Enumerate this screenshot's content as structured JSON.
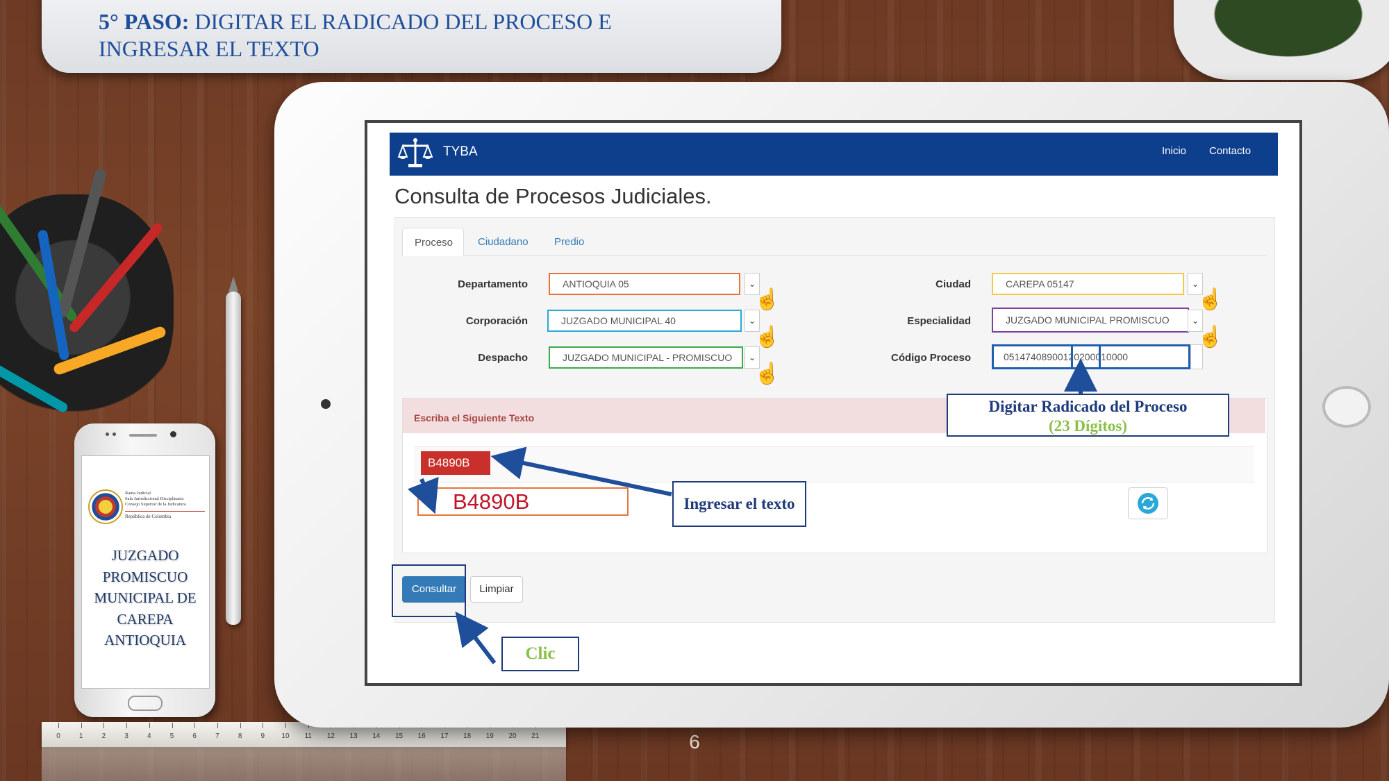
{
  "slide": {
    "title_bold": "5° PASO:",
    "title_rest": " DIGITAR EL RADICADO DEL PROCESO E INGRESAR EL TEXTO",
    "page_number": "6"
  },
  "phone": {
    "seal_lines": [
      "Rama Judicial",
      "Sala Jurisdiccional Disciplinaria",
      "Consejo Superior de la Judicatura"
    ],
    "seal_country": "República de Colombia",
    "title": "JUZGADO PROMISCUO MUNICIPAL DE CAREPA ANTIOQUIA"
  },
  "ruler": {
    "marks": [
      "0",
      "1",
      "2",
      "3",
      "4",
      "5",
      "6",
      "7",
      "8",
      "9",
      "10",
      "11",
      "12",
      "13",
      "14",
      "15",
      "16",
      "17",
      "18",
      "19",
      "20",
      "21"
    ]
  },
  "app": {
    "brand": "TYBA",
    "nav": {
      "inicio": "Inicio",
      "contacto": "Contacto"
    },
    "heading": "Consulta de Procesos Judiciales.",
    "tabs": [
      {
        "label": "Proceso",
        "active": true
      },
      {
        "label": "Ciudadano",
        "active": false
      },
      {
        "label": "Predio",
        "active": false
      }
    ],
    "form": {
      "departamento": {
        "label": "Departamento",
        "value": "ANTIOQUIA 05",
        "color": "#e8743b"
      },
      "corporacion": {
        "label": "Corporación",
        "value": "JUZGADO MUNICIPAL 40",
        "color": "#2aa9d8"
      },
      "despacho": {
        "label": "Despacho",
        "value": "JUZGADO MUNICIPAL - PROMISCUO",
        "color": "#3aaa4a"
      },
      "ciudad": {
        "label": "Ciudad",
        "value": "CAREPA 05147",
        "color": "#f2c94c"
      },
      "especialidad": {
        "label": "Especialidad",
        "value": "JUZGADO MUNICIPAL PROMISCUO",
        "color": "#7b3fa0"
      },
      "codigo": {
        "label": "Código Proceso",
        "value": "05147408900120200010000"
      }
    },
    "captcha": {
      "title": "Escriba el Siguiente Texto",
      "image_text": "B4890B",
      "input_value": "B4890B"
    },
    "buttons": {
      "consultar": "Consultar",
      "limpiar": "Limpiar"
    }
  },
  "callouts": {
    "radicado_line1": "Digitar Radicado del Proceso",
    "radicado_line2": "(23 Dígitos)",
    "texto": "Ingresar el texto",
    "clic": "Clic"
  },
  "colors": {
    "navbar": "#0d3f8c",
    "accent_blue": "#1e3a7a",
    "callout_green": "#8cbf4a"
  }
}
